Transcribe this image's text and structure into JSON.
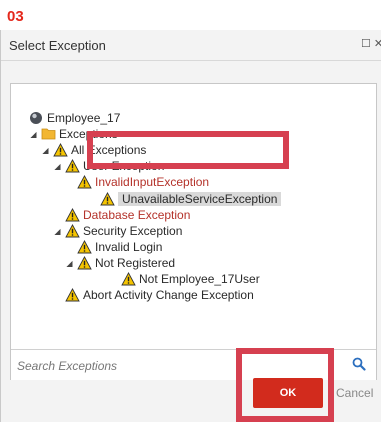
{
  "step_number": "03",
  "dialog": {
    "title": "Select Exception",
    "window_buttons": "☐ ✕"
  },
  "tree": [
    {
      "name": "root",
      "label": "Employee_17",
      "icon": "globe-icon",
      "expander": "",
      "text_style": "normal"
    },
    {
      "name": "exceptions",
      "label": "Exceptions",
      "icon": "folder-icon",
      "expander": "◢",
      "text_style": "normal"
    },
    {
      "name": "all-exceptions",
      "label": "All Exceptions",
      "icon": "warning-icon",
      "expander": "◢",
      "text_style": "normal"
    },
    {
      "name": "user-exception",
      "label": "User Exception",
      "icon": "warning-icon",
      "expander": "◢",
      "text_style": "normal"
    },
    {
      "name": "invalid-input-exception",
      "label": "InvalidInputException",
      "icon": "warning-icon",
      "expander": "",
      "text_style": "red"
    },
    {
      "name": "unavailable-service-exception",
      "label": "UnavailableServiceException",
      "icon": "warning-icon",
      "expander": "",
      "text_style": "selected"
    },
    {
      "name": "database-exception",
      "label": "Database Exception",
      "icon": "warning-icon",
      "expander": "",
      "text_style": "red"
    },
    {
      "name": "security-exception",
      "label": "Security Exception",
      "icon": "warning-icon",
      "expander": "◢",
      "text_style": "normal"
    },
    {
      "name": "invalid-login",
      "label": "Invalid Login",
      "icon": "warning-icon",
      "expander": "",
      "text_style": "normal"
    },
    {
      "name": "not-registered",
      "label": "Not Registered",
      "icon": "warning-icon",
      "expander": "◢",
      "text_style": "normal"
    },
    {
      "name": "not-employee-17-user",
      "label": "Not Employee_17User",
      "icon": "warning-icon",
      "expander": "",
      "text_style": "normal"
    },
    {
      "name": "abort-activity-change-exception",
      "label": "Abort Activity Change Exception",
      "icon": "warning-icon",
      "expander": "",
      "text_style": "normal"
    }
  ],
  "search": {
    "placeholder": "Search Exceptions"
  },
  "buttons": {
    "ok": "OK",
    "cancel": "Cancel"
  },
  "colors": {
    "step": "#e4281c",
    "ok_button": "#d22b1d",
    "highlight": "#d64050",
    "warning_yellow": "#f5c400",
    "folder": "#f2b632",
    "search_icon": "#2c6fbf"
  }
}
